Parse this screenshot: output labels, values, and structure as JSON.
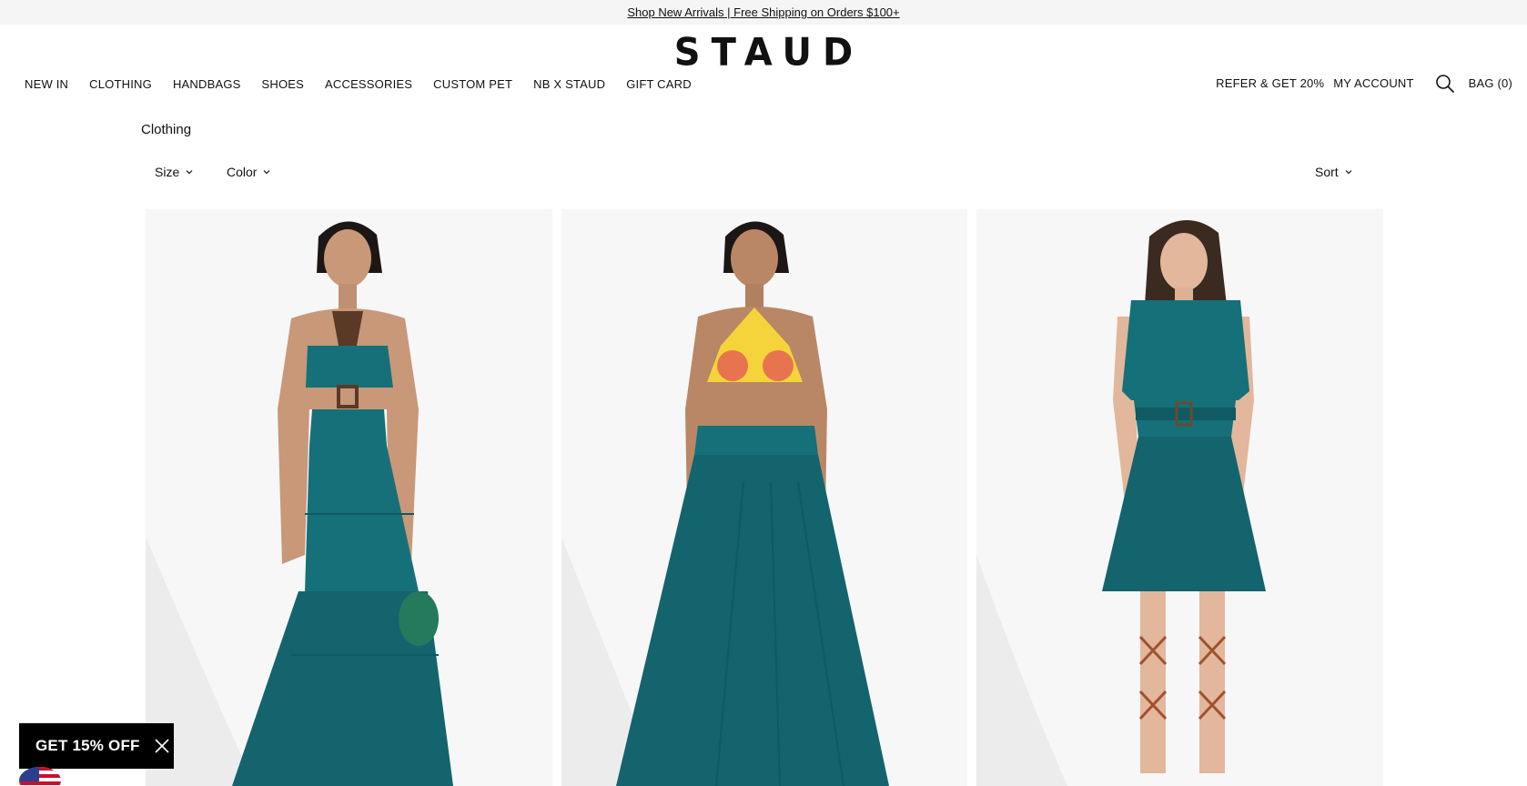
{
  "promo": {
    "text": "Shop New Arrivals | Free Shipping on Orders $100+"
  },
  "brand": {
    "logo": "STAUD"
  },
  "nav": {
    "left": [
      "NEW IN",
      "CLOTHING",
      "HANDBAGS",
      "SHOES",
      "ACCESSORIES",
      "CUSTOM PET",
      "NB X STAUD",
      "GIFT CARD"
    ],
    "refer": "REFER & GET 20%",
    "account": "MY ACCOUNT",
    "bag": "BAG (0)"
  },
  "page": {
    "title": "Clothing"
  },
  "filters": {
    "size": "Size",
    "color": "Color",
    "sort": "Sort"
  },
  "products": [
    {
      "description": "teal halter cutout tiered maxi dress"
    },
    {
      "description": "fruit-print bikini top with teal maxi skirt"
    },
    {
      "description": "teal belted sleeveless shirt dress"
    }
  ],
  "popup": {
    "label": "GET 15% OFF"
  },
  "colors": {
    "teal": "#16707a",
    "teal_dark": "#0f5a63",
    "skin": "#c89878",
    "bg": "#f7f7f7"
  }
}
